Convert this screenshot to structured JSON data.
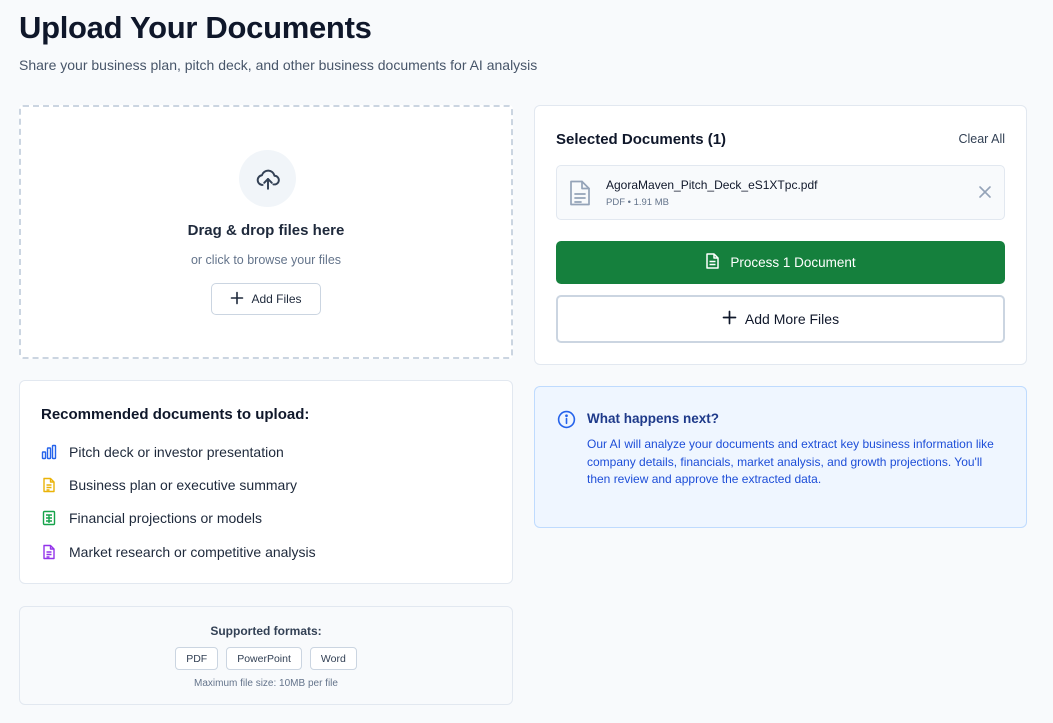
{
  "header": {
    "title": "Upload Your Documents",
    "subtitle": "Share your business plan, pitch deck, and other business documents for AI analysis"
  },
  "dropzone": {
    "title": "Drag & drop files here",
    "subtitle": "or click to browse your files",
    "add_files_label": "Add Files"
  },
  "recommended": {
    "title": "Recommended documents to upload:",
    "items": [
      {
        "label": "Pitch deck or investor presentation",
        "icon": "bar-chart-icon",
        "color": "#2563eb"
      },
      {
        "label": "Business plan or executive summary",
        "icon": "document-icon",
        "color": "#eab308"
      },
      {
        "label": "Financial projections or models",
        "icon": "spreadsheet-icon",
        "color": "#16a34a"
      },
      {
        "label": "Market research or competitive analysis",
        "icon": "document-icon",
        "color": "#9333ea"
      }
    ]
  },
  "formats": {
    "title": "Supported formats:",
    "chips": [
      "PDF",
      "PowerPoint",
      "Word"
    ],
    "note": "Maximum file size: 10MB per file"
  },
  "selected": {
    "title": "Selected Documents (1)",
    "clear_all": "Clear All",
    "files": [
      {
        "name": "AgoraMaven_Pitch_Deck_eS1XTpc.pdf",
        "meta": "PDF • 1.91 MB"
      }
    ],
    "process_label": "Process 1 Document",
    "add_more_label": "Add More Files"
  },
  "info": {
    "title": "What happens next?",
    "text": "Our AI will analyze your documents and extract key business information like company details, financials, market analysis, and growth projections. You'll then review and approve the extracted data."
  },
  "colors": {
    "primary_green": "#15803d",
    "info_blue": "#1d4ed8"
  }
}
